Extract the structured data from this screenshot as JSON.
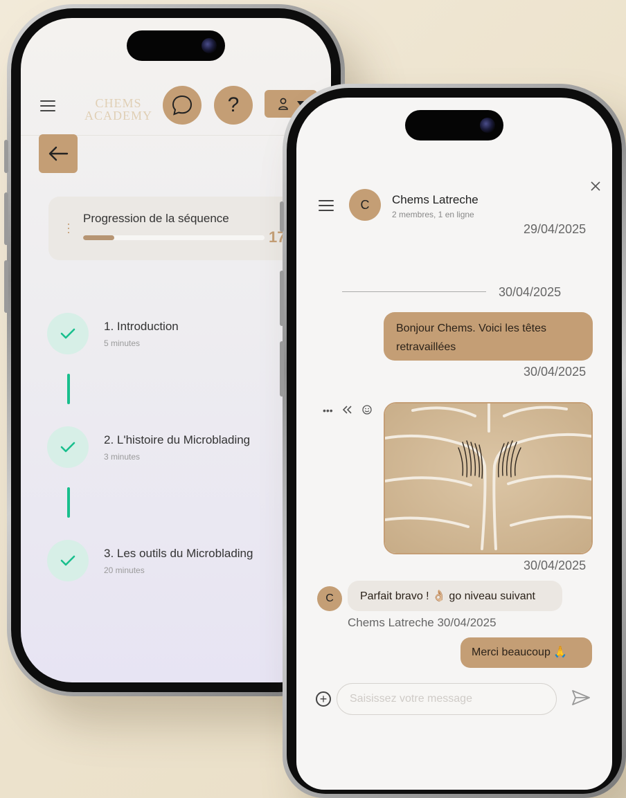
{
  "left_app": {
    "logo_line1": "CHEMS",
    "logo_line2": "ACADEMY",
    "chat_icon": "chat-bubble-icon",
    "help_label": "?",
    "progress": {
      "title": "Progression de la séquence",
      "value_text": "17",
      "fraction": 0.17
    },
    "lessons": [
      {
        "title": "1. Introduction",
        "duration": "5 minutes",
        "completed": true
      },
      {
        "title": "2. L'histoire du Microblading",
        "duration": "3 minutes",
        "completed": true
      },
      {
        "title": "3. Les outils du Microblading",
        "duration": "20 minutes",
        "completed": true
      }
    ]
  },
  "chat": {
    "contact_initial": "C",
    "contact_name": "Chems Latreche",
    "contact_meta": "2 membres, 1 en ligne",
    "first_date": "29/04/2025",
    "separator_date": "30/04/2025",
    "messages": [
      {
        "from": "me",
        "text": "Bonjour Chems. Voici les têtes retravaillées",
        "date": "30/04/2025"
      },
      {
        "from": "me",
        "type": "image",
        "date": "30/04/2025"
      },
      {
        "from": "other",
        "text": "Parfait bravo ! 👌🏼 go niveau suivant",
        "author_line": "Chems Latreche 30/04/2025"
      },
      {
        "from": "me",
        "text": "Merci beaucoup 🙏"
      }
    ],
    "composer_placeholder": "Saisissez votre message"
  },
  "colors": {
    "accent": "#c49e75",
    "success": "#19bf8d",
    "success_soft": "#d7efe7",
    "background": "#efe6d3"
  }
}
